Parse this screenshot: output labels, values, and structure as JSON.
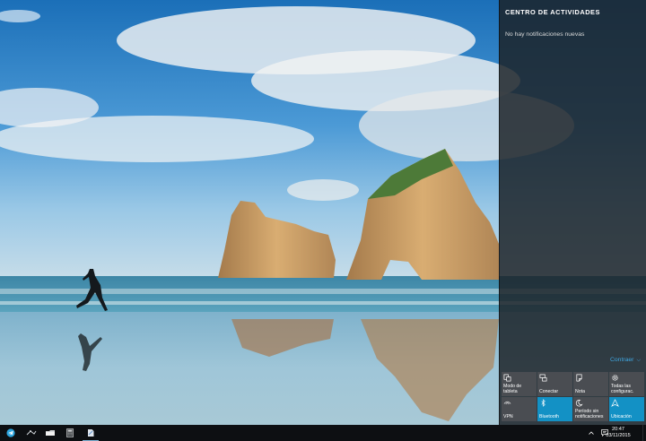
{
  "action_center": {
    "title": "CENTRO DE ACTIVIDADES",
    "empty_message": "No hay notificaciones nuevas",
    "collapse_label": "Contraer",
    "tiles": [
      {
        "label": "Modo de tableta",
        "icon": "tablet-mode-icon",
        "active": false
      },
      {
        "label": "Conectar",
        "icon": "connect-icon",
        "active": false
      },
      {
        "label": "Nota",
        "icon": "note-icon",
        "active": false
      },
      {
        "label": "Todas las configurac.",
        "icon": "settings-gear-icon",
        "active": false
      },
      {
        "label": "VPN",
        "icon": "vpn-icon",
        "active": false
      },
      {
        "label": "Bluetooth",
        "icon": "bluetooth-icon",
        "active": true
      },
      {
        "label": "Período sin notificaciones",
        "icon": "moon-icon",
        "active": false
      },
      {
        "label": "Ubicación",
        "icon": "location-icon",
        "active": true
      }
    ]
  },
  "taskbar": {
    "apps": [
      "telegram-icon",
      "app-icon",
      "folder-icon",
      "calculator-icon",
      "document-icon"
    ],
    "clock": {
      "time": "20:47",
      "date": "03/11/2015"
    }
  },
  "colors": {
    "accent": "#1391c5",
    "tile_inactive": "#4a4d52",
    "link": "#3fa7e0",
    "panel": "#1c2126"
  }
}
